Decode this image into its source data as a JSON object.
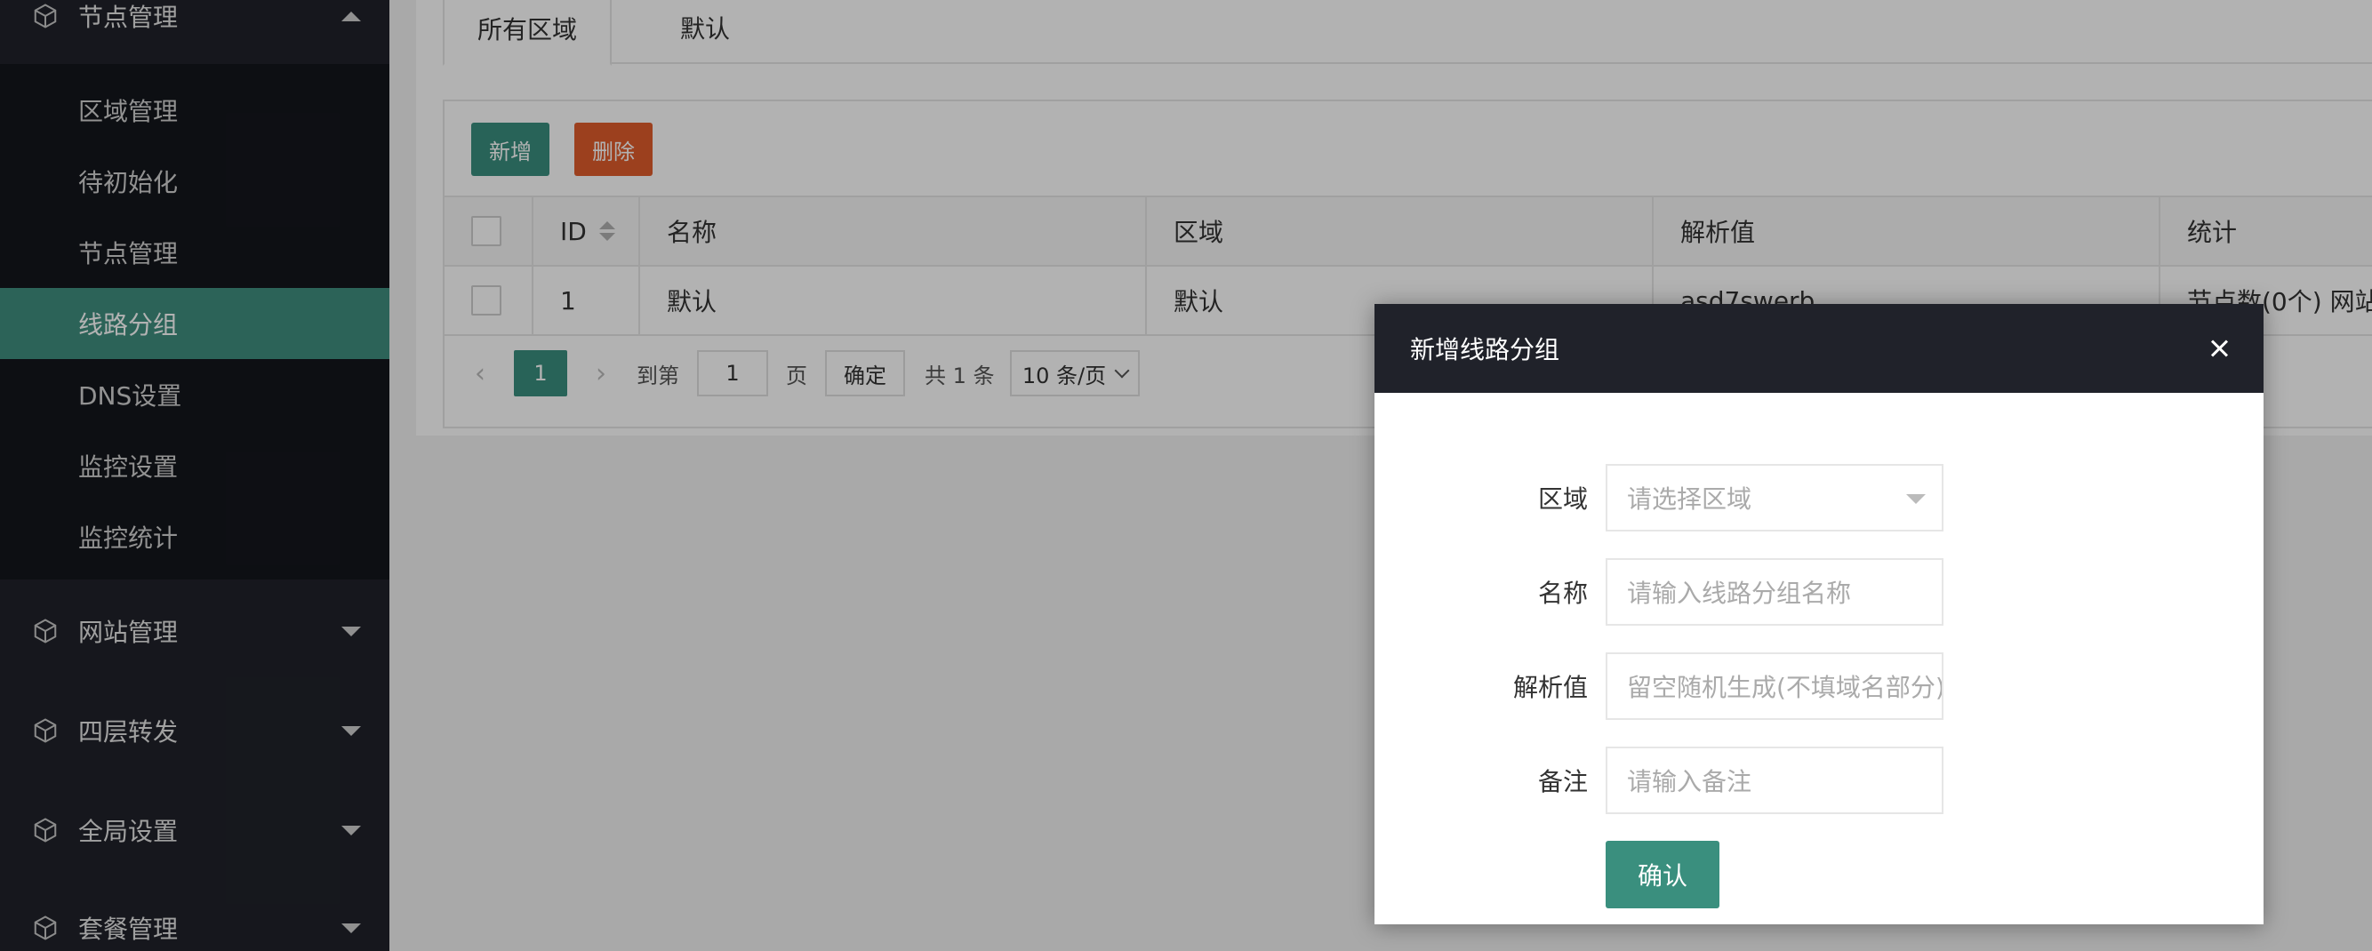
{
  "sidebar": {
    "node_menu": {
      "label": "节点管理",
      "icon": "cube-icon"
    },
    "node_sub": [
      {
        "label": "区域管理"
      },
      {
        "label": "待初始化"
      },
      {
        "label": "节点管理"
      },
      {
        "label": "线路分组"
      },
      {
        "label": "DNS设置"
      },
      {
        "label": "监控设置"
      },
      {
        "label": "监控统计"
      }
    ],
    "menus": [
      {
        "label": "网站管理",
        "icon": "cube-icon"
      },
      {
        "label": "四层转发",
        "icon": "cube-icon"
      },
      {
        "label": "全局设置",
        "icon": "cube-icon"
      },
      {
        "label": "套餐管理",
        "icon": "cube-icon"
      }
    ]
  },
  "tabs": [
    {
      "label": "所有区域"
    },
    {
      "label": "默认"
    }
  ],
  "toolbar": {
    "add_label": "新增",
    "delete_label": "删除"
  },
  "table": {
    "columns": [
      "ID",
      "名称",
      "区域",
      "解析值",
      "统计"
    ],
    "rows": [
      {
        "id": "1",
        "name": "默认",
        "region": "默认",
        "value": "asd7swerb",
        "stats": "节点数(0个) 网站"
      }
    ]
  },
  "pagination": {
    "current": "1",
    "goto_label": "到第",
    "goto_value": "1",
    "page_suffix": "页",
    "ok_label": "确定",
    "total": "共 1 条",
    "page_size": "10 条/页"
  },
  "modal": {
    "title": "新增线路分组",
    "fields": [
      {
        "label": "区域",
        "placeholder": "请选择区域"
      },
      {
        "label": "名称",
        "placeholder": "请输入线路分组名称"
      },
      {
        "label": "解析值",
        "placeholder": "留空随机生成(不填域名部分)"
      },
      {
        "label": "备注",
        "placeholder": "请输入备注"
      }
    ],
    "confirm_label": "确认"
  },
  "colors": {
    "accent": "#3a8f7e",
    "danger": "#e05c2c",
    "sidebar": "#20222a"
  }
}
